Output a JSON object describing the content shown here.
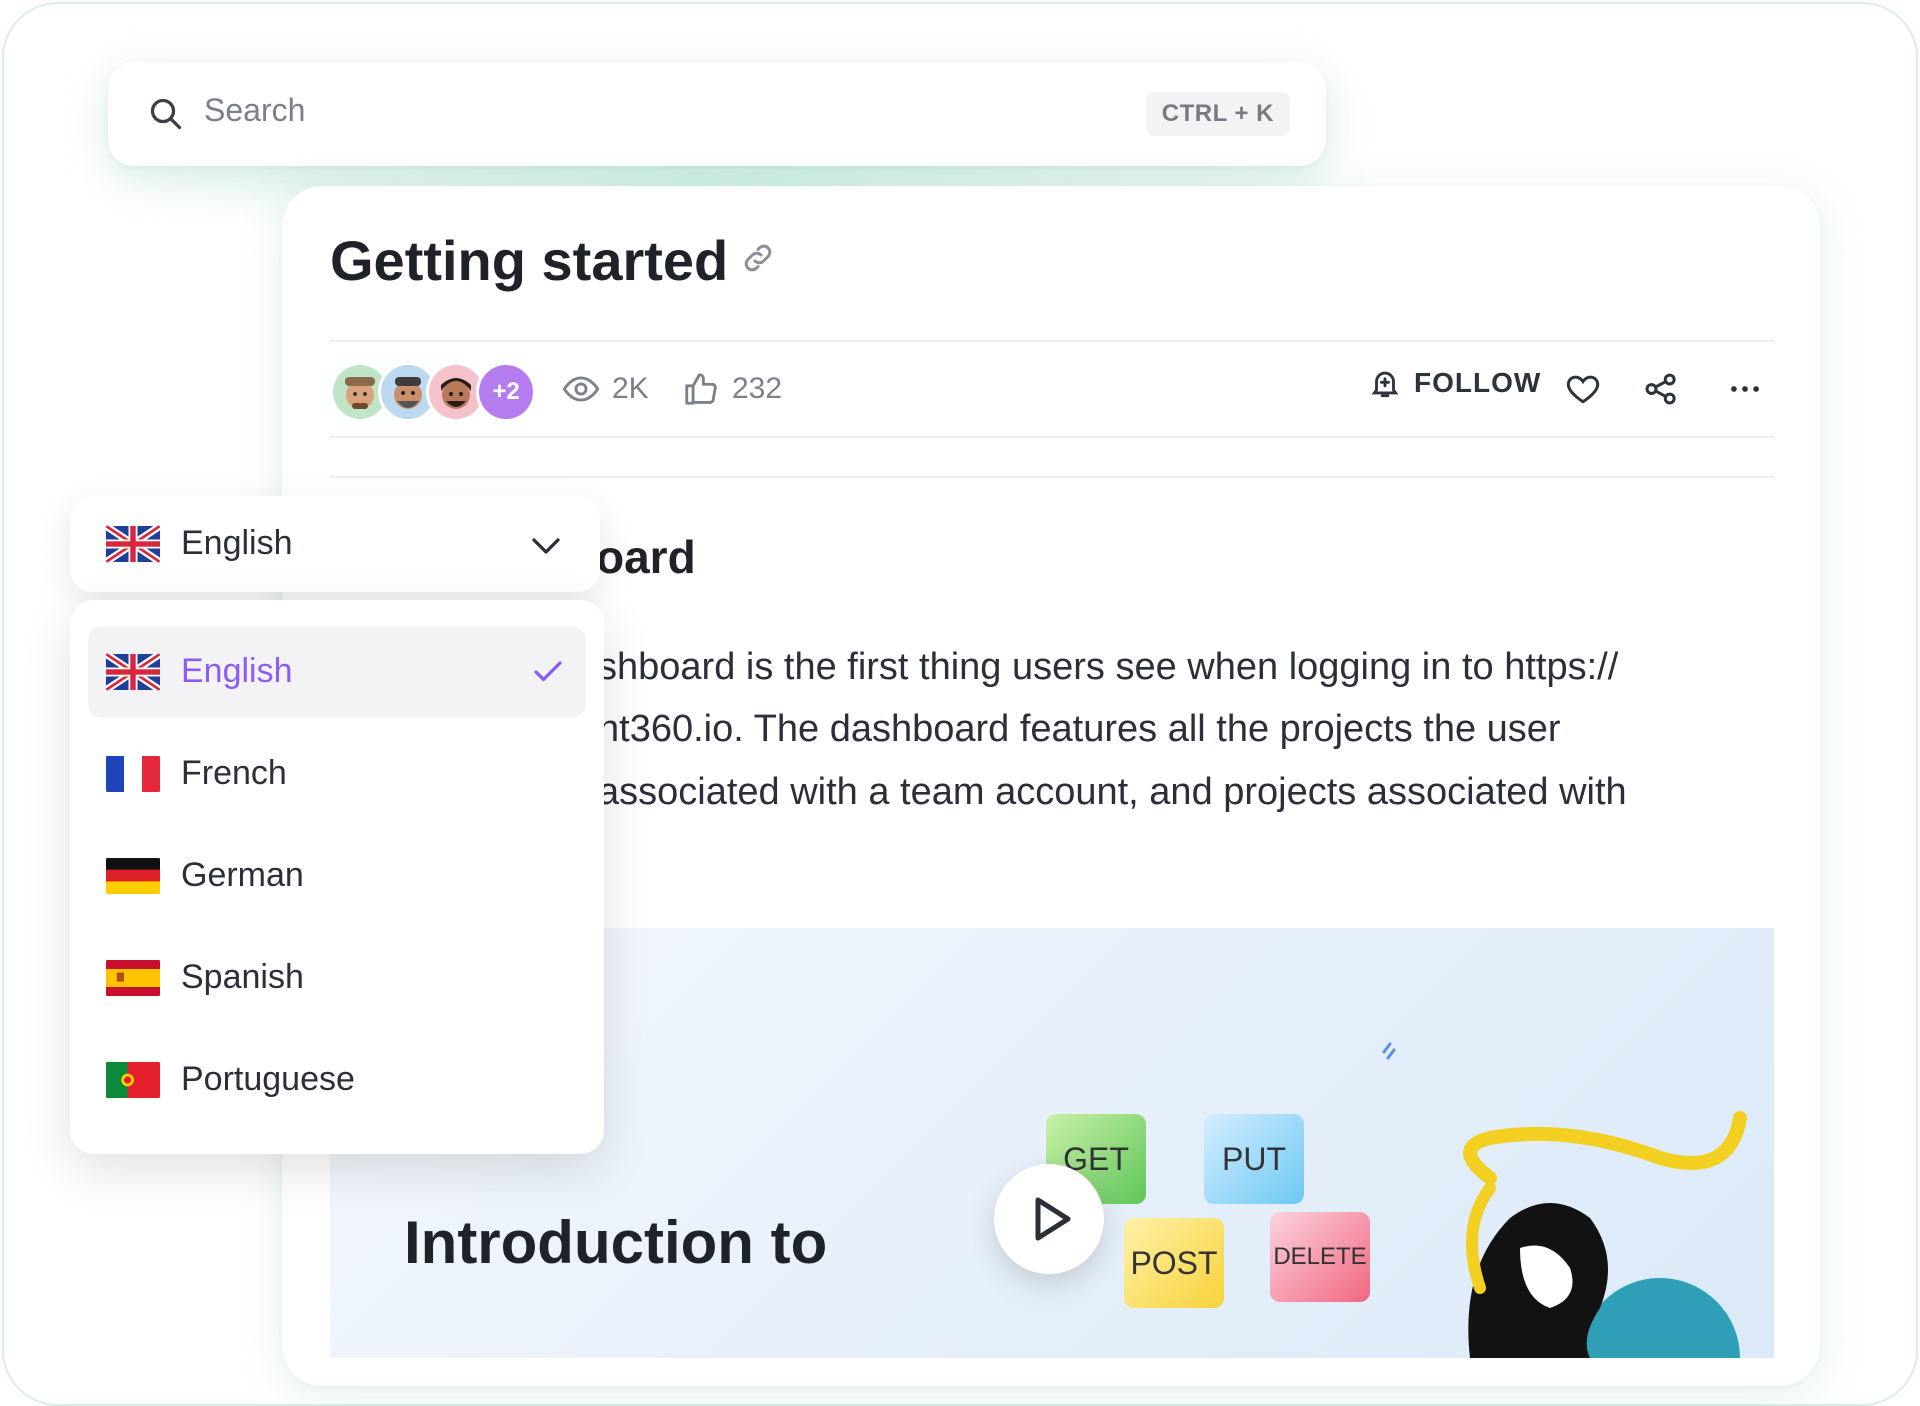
{
  "search": {
    "placeholder": "Search",
    "shortcut": "CTRL + K"
  },
  "article": {
    "title": "Getting started",
    "stats": {
      "avatar_overflow": "+2",
      "views": "2K",
      "likes": "232"
    },
    "follow_label": "FOLLOW",
    "section_heading": "oard",
    "paragraph_lines": [
      "shboard is the first thing users see when logging in to https://",
      "nt360.io. The dashboard features all the projects the user",
      "associated with a team account, and projects associated with"
    ],
    "video": {
      "title": "Introduction to",
      "chips": [
        "GET",
        "PUT",
        "POST",
        "DELETE"
      ]
    }
  },
  "language": {
    "selected": "English",
    "options": [
      {
        "label": "English",
        "flag": "uk-flag",
        "selected": true
      },
      {
        "label": "French",
        "flag": "france-flag",
        "selected": false
      },
      {
        "label": "German",
        "flag": "germany-flag",
        "selected": false
      },
      {
        "label": "Spanish",
        "flag": "spain-flag",
        "selected": false
      },
      {
        "label": "Portuguese",
        "flag": "portugal-flag",
        "selected": false
      }
    ]
  },
  "colors": {
    "accent": "#8b5cf6",
    "border": "#dbeee9",
    "avatar_more": "#b57cf0"
  }
}
